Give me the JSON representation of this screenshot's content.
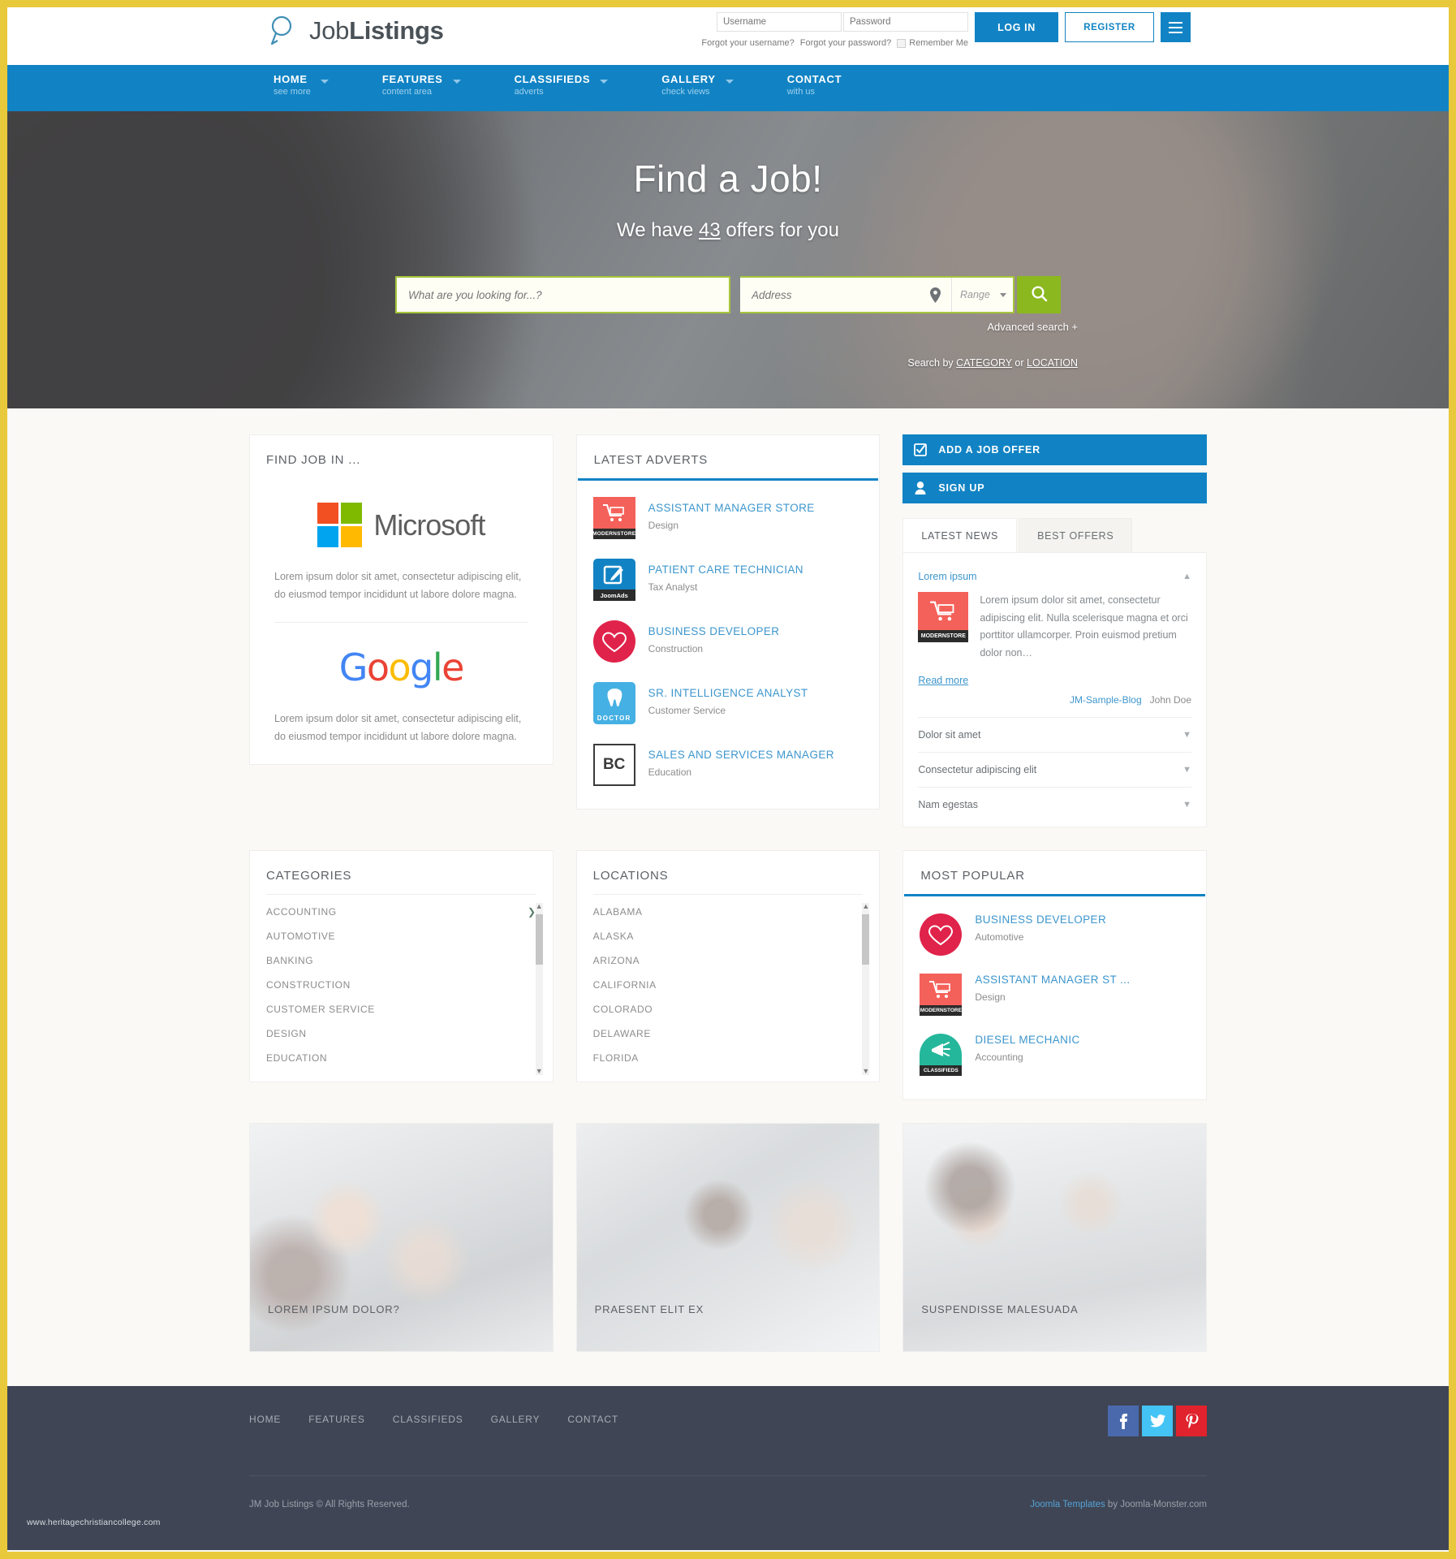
{
  "brand": {
    "name_light": "Job",
    "name_bold": "Listings",
    "logo_icon": "magnifier-icon"
  },
  "auth": {
    "username_placeholder": "Username",
    "password_placeholder": "Password",
    "username_value": "",
    "password_value": "",
    "forgot_username": "Forgot your username?",
    "forgot_password": "Forgot your password?",
    "remember_me": "Remember Me",
    "login_label": "LOG IN",
    "register_label": "REGISTER",
    "menu_icon": "hamburger-icon"
  },
  "nav": {
    "items": [
      {
        "label": "HOME",
        "sub": "see more",
        "caret": true
      },
      {
        "label": "FEATURES",
        "sub": "content area",
        "caret": true
      },
      {
        "label": "CLASSIFIEDS",
        "sub": "adverts",
        "caret": true
      },
      {
        "label": "GALLERY",
        "sub": "check views",
        "caret": true
      },
      {
        "label": "CONTACT",
        "sub": "with us",
        "caret": false
      }
    ]
  },
  "hero": {
    "title": "Find a Job!",
    "sub_before": "We have ",
    "sub_count": "43",
    "sub_after": " offers for you",
    "keyword_placeholder": "What are you looking for...?",
    "keyword_value": "",
    "address_placeholder": "Address",
    "address_value": "",
    "range_label": "Range",
    "pin_icon": "map-pin-icon",
    "search_icon": "search-icon",
    "advanced_search": "Advanced search +",
    "search_by_prefix": "Search by ",
    "search_by_category": "CATEGORY",
    "search_by_or": " or ",
    "search_by_location": "LOCATION"
  },
  "find_job": {
    "title": "FIND JOB IN ...",
    "brands": [
      {
        "logo": "microsoft-logo",
        "name": "Microsoft",
        "desc": "Lorem ipsum dolor sit amet, consectetur adipiscing elit, do eiusmod tempor incididunt ut labore dolore magna."
      },
      {
        "logo": "google-logo",
        "name": "Google",
        "desc": "Lorem ipsum dolor sit amet, consectetur adipiscing elit, do eiusmod tempor incididunt ut labore dolore magna."
      }
    ]
  },
  "latest_adverts": {
    "title": "LATEST ADVERTS",
    "items": [
      {
        "name": "ASSISTANT MANAGER STORE",
        "category": "Design",
        "icon": "modernstore-cart-icon",
        "badge": "MODERNSTORE"
      },
      {
        "name": "PATIENT CARE TECHNICIAN",
        "category": "Tax Analyst",
        "icon": "joomads-pencil-icon",
        "badge": "JoomAds"
      },
      {
        "name": "BUSINESS DEVELOPER",
        "category": "Construction",
        "icon": "heart-icon",
        "badge": ""
      },
      {
        "name": "SR. INTELLIGENCE ANALYST",
        "category": "Customer Service",
        "icon": "doctor-tooth-icon",
        "badge": "DOCTOR"
      },
      {
        "name": "SALES AND SERVICES MANAGER",
        "category": "Education",
        "icon": "bc-logo-icon",
        "badge": "BC"
      }
    ]
  },
  "actions": {
    "add_job_offer": "ADD A JOB OFFER",
    "add_job_icon": "checkbox-icon",
    "sign_up": "SIGN UP",
    "sign_up_icon": "user-icon"
  },
  "news_panel": {
    "tabs": [
      {
        "label": "LATEST NEWS",
        "active": true
      },
      {
        "label": "BEST OFFERS",
        "active": false
      }
    ],
    "featured": {
      "title": "Lorem ipsum",
      "body": "Lorem ipsum dolor sit amet, consectetur adipiscing elit. Nulla scelerisque magna et orci porttitor ullamcorper. Proin euismod pretium dolor non…",
      "read_more": "Read more",
      "blog": "JM-Sample-Blog",
      "author": "John Doe",
      "thumb_icon": "modernstore-cart-icon",
      "thumb_badge": "MODERNSTORE"
    },
    "collapsed": [
      "Dolor sit amet",
      "Consectetur adipiscing elit",
      "Nam egestas"
    ]
  },
  "categories": {
    "title": "CATEGORIES",
    "items": [
      {
        "label": "ACCOUNTING",
        "arrow": true
      },
      {
        "label": "AUTOMOTIVE",
        "arrow": false
      },
      {
        "label": "BANKING",
        "arrow": false
      },
      {
        "label": "CONSTRUCTION",
        "arrow": false
      },
      {
        "label": "CUSTOMER SERVICE",
        "arrow": false
      },
      {
        "label": "DESIGN",
        "arrow": false
      },
      {
        "label": "EDUCATION",
        "arrow": false
      }
    ]
  },
  "locations": {
    "title": "LOCATIONS",
    "items": [
      {
        "label": "ALABAMA"
      },
      {
        "label": "ALASKA"
      },
      {
        "label": "ARIZONA"
      },
      {
        "label": "CALIFORNIA"
      },
      {
        "label": "COLORADO"
      },
      {
        "label": "DELAWARE"
      },
      {
        "label": "FLORIDA"
      }
    ]
  },
  "most_popular": {
    "title": "MOST POPULAR",
    "items": [
      {
        "name": "BUSINESS DEVELOPER",
        "category": "Automotive",
        "icon": "heart-icon",
        "badge": ""
      },
      {
        "name": "ASSISTANT MANAGER ST ...",
        "category": "Design",
        "icon": "modernstore-cart-icon",
        "badge": "MODERNSTORE"
      },
      {
        "name": "DIESEL MECHANIC",
        "category": "Accounting",
        "icon": "classifieds-megaphone-icon",
        "badge": "CLASSIFIEDS"
      }
    ]
  },
  "photo_cards": [
    {
      "caption": "LOREM IPSUM DOLOR?"
    },
    {
      "caption": "PRAESENT ELIT EX"
    },
    {
      "caption": "SUSPENDISSE MALESUADA"
    }
  ],
  "footer": {
    "nav": [
      "HOME",
      "FEATURES",
      "CLASSIFIEDS",
      "GALLERY",
      "CONTACT"
    ],
    "social": [
      {
        "name": "facebook-icon",
        "glyph": "f",
        "color": "#4a69ad"
      },
      {
        "name": "twitter-icon",
        "glyph": "t",
        "color": "#44c4f5"
      },
      {
        "name": "pinterest-icon",
        "glyph": "p",
        "color": "#e0232c"
      }
    ],
    "copyright": "JM Job Listings © All Rights Reserved.",
    "credit_link": "Joomla Templates",
    "credit_rest": " by Joomla-Monster.com",
    "watermark": "www.heritagechristiancollege.com"
  },
  "colors": {
    "brand_blue": "#1183c4",
    "link_blue": "#3d96cd",
    "accent_green": "#8bb81e",
    "border_green": "#a6c63c",
    "page_border_yellow": "#e8c93c",
    "footer_dark": "#3f4554"
  }
}
